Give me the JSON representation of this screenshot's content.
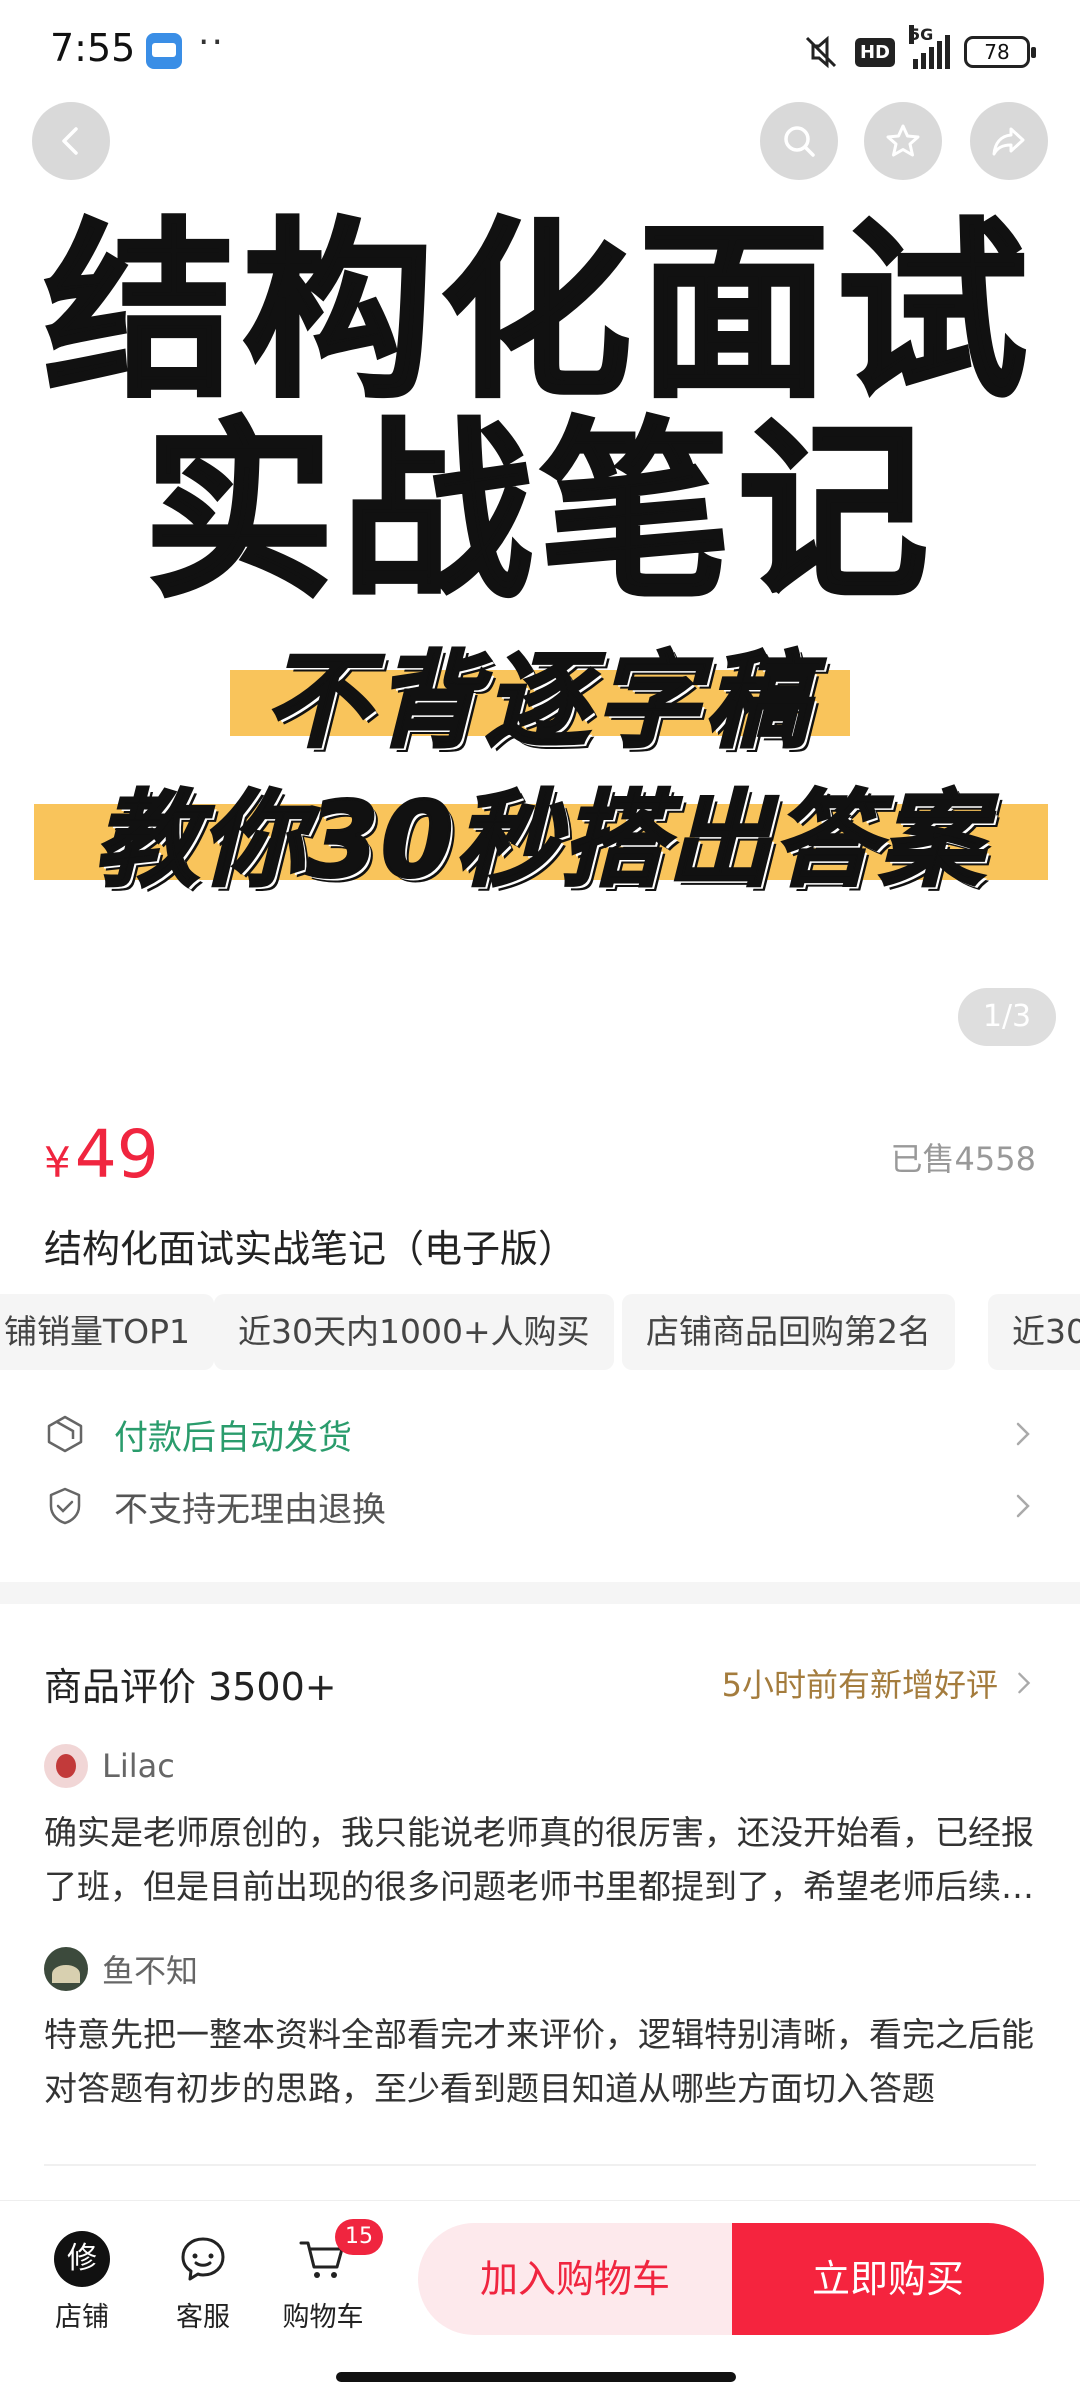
{
  "status_bar": {
    "time": "7:55",
    "dots": "··",
    "network": "5G",
    "hd": "HD",
    "battery": "78"
  },
  "hero": {
    "title_line1": "结构化面试",
    "title_line2": "实战笔记",
    "subtitle_line1": "不背逐字稿",
    "subtitle_line2": "教你30秒搭出答案",
    "page_indicator": "1/3",
    "highlight_color": "#f9c45b"
  },
  "product": {
    "currency": "¥",
    "price": "49",
    "sold": "已售4558",
    "title": "结构化面试实战笔记（电子版）",
    "tags": [
      "铺销量TOP1",
      "近30天内1000+人购买",
      "店铺商品回购第2名",
      "近30"
    ]
  },
  "services": [
    {
      "label": "付款后自动发货",
      "icon": "box-icon"
    },
    {
      "label": "不支持无理由退换",
      "icon": "shield-check-icon"
    }
  ],
  "reviews": {
    "header": "商品评价 3500+",
    "new_notice": "5小时前有新增好评",
    "items": [
      {
        "user": "Lilac",
        "text": "确实是老师原创的，我只能说老师真的很厉害，还没开始看，已经报了班，但是目前出现的很多问题老师书里都提到了，希望老师后续能出更多资料"
      },
      {
        "user": "鱼不知",
        "text": "特意先把一整本资料全部看完才来评价，逻辑特别清晰，看完之后能对答题有初步的思路，至少看到题目知道从哪些方面切入答题"
      }
    ]
  },
  "bottom_bar": {
    "shop_label": "店铺",
    "shop_logo_char": "修",
    "service_label": "客服",
    "cart_label": "购物车",
    "cart_badge": "15",
    "add_to_cart": "加入购物车",
    "buy_now": "立即购买"
  },
  "colors": {
    "accent": "#f0253f",
    "green": "#2a9c6c",
    "gold": "#a47c3d"
  }
}
